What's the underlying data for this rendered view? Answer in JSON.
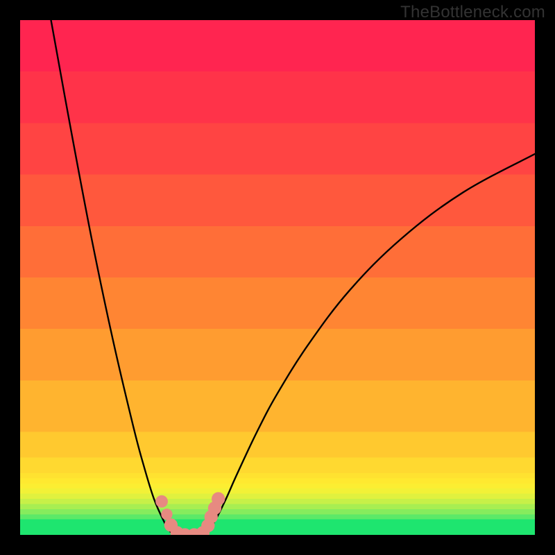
{
  "watermark": "TheBottleneck.com",
  "chart_data": {
    "type": "line",
    "title": "",
    "xlabel": "",
    "ylabel": "",
    "xlim": [
      0,
      100
    ],
    "ylim": [
      0,
      100
    ],
    "background_bands": [
      {
        "y0": 0,
        "y1": 3,
        "color": "#1ee56f"
      },
      {
        "y0": 3,
        "y1": 4,
        "color": "#5ce968"
      },
      {
        "y0": 4,
        "y1": 5,
        "color": "#86ec5d"
      },
      {
        "y0": 5,
        "y1": 6,
        "color": "#a8ee52"
      },
      {
        "y0": 6,
        "y1": 7,
        "color": "#c7f048"
      },
      {
        "y0": 7,
        "y1": 8,
        "color": "#e0f13f"
      },
      {
        "y0": 8,
        "y1": 9,
        "color": "#f2f137"
      },
      {
        "y0": 9,
        "y1": 10,
        "color": "#fcee32"
      },
      {
        "y0": 10,
        "y1": 11,
        "color": "#ffe930"
      },
      {
        "y0": 11,
        "y1": 12,
        "color": "#ffe230"
      },
      {
        "y0": 12,
        "y1": 15,
        "color": "#ffd930"
      },
      {
        "y0": 15,
        "y1": 20,
        "color": "#ffc92f"
      },
      {
        "y0": 20,
        "y1": 30,
        "color": "#ffb42f"
      },
      {
        "y0": 30,
        "y1": 40,
        "color": "#ff9c30"
      },
      {
        "y0": 40,
        "y1": 50,
        "color": "#ff8533"
      },
      {
        "y0": 50,
        "y1": 60,
        "color": "#ff6e38"
      },
      {
        "y0": 60,
        "y1": 70,
        "color": "#ff583d"
      },
      {
        "y0": 70,
        "y1": 80,
        "color": "#ff4443"
      },
      {
        "y0": 80,
        "y1": 90,
        "color": "#ff3349"
      },
      {
        "y0": 90,
        "y1": 100,
        "color": "#ff2550"
      }
    ],
    "series": [
      {
        "name": "left-branch",
        "x": [
          6.0,
          10.0,
          14.0,
          18.0,
          22.0,
          24.0,
          26.0,
          28.0,
          29.0,
          30.0
        ],
        "y": [
          100.0,
          78.0,
          57.0,
          38.0,
          21.0,
          13.5,
          7.0,
          2.5,
          0.8,
          0.0
        ]
      },
      {
        "name": "right-branch",
        "x": [
          36.0,
          38.0,
          40.0,
          42.0,
          46.0,
          50.0,
          56.0,
          64.0,
          74.0,
          86.0,
          100.0
        ],
        "y": [
          0.0,
          3.0,
          7.0,
          11.5,
          20.0,
          27.5,
          37.0,
          47.5,
          57.5,
          66.5,
          74.0
        ]
      }
    ],
    "markers": [
      {
        "x": 27.5,
        "y": 6.5,
        "r": 1.2
      },
      {
        "x": 28.5,
        "y": 4.0,
        "r": 1.1
      },
      {
        "x": 29.3,
        "y": 1.9,
        "r": 1.3
      },
      {
        "x": 30.5,
        "y": 0.4,
        "r": 1.3
      },
      {
        "x": 32.0,
        "y": 0.0,
        "r": 1.3
      },
      {
        "x": 33.8,
        "y": 0.0,
        "r": 1.3
      },
      {
        "x": 35.5,
        "y": 0.4,
        "r": 1.3
      },
      {
        "x": 36.5,
        "y": 1.8,
        "r": 1.3
      },
      {
        "x": 37.1,
        "y": 3.5,
        "r": 1.3
      },
      {
        "x": 37.8,
        "y": 5.2,
        "r": 1.3
      },
      {
        "x": 38.5,
        "y": 7.0,
        "r": 1.3
      }
    ],
    "marker_color": "#e78a81",
    "curve_color": "#000000"
  }
}
